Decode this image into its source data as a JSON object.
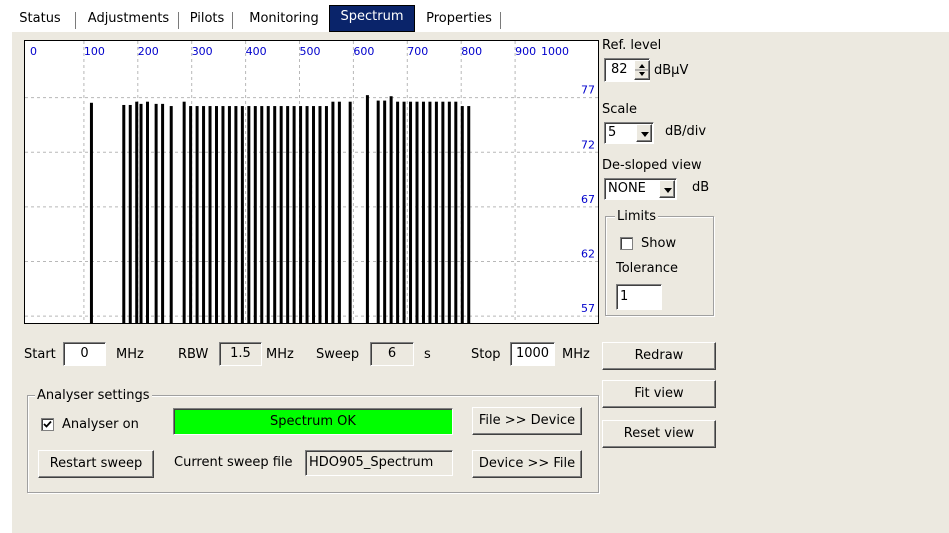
{
  "tabs": [
    {
      "label": "Status",
      "active": false
    },
    {
      "label": "Adjustments",
      "active": false
    },
    {
      "label": "Pilots",
      "active": false
    },
    {
      "label": "Monitoring",
      "active": false
    },
    {
      "label": "Spectrum",
      "active": true
    },
    {
      "label": "Properties",
      "active": false
    }
  ],
  "chart_data": {
    "type": "bar",
    "x_ticks": [
      0,
      100,
      200,
      300,
      400,
      500,
      600,
      700,
      800,
      900,
      1000
    ],
    "y_ticks": [
      77,
      72,
      67,
      62,
      57
    ],
    "xlim": [
      0,
      1000
    ],
    "ylim": [
      56,
      81
    ],
    "grid": true,
    "bar_color": "#000000",
    "tick_color": "#0000cc",
    "series": [
      {
        "x": [
          114,
          174,
          186,
          198,
          206,
          218,
          234,
          246,
          262,
          286,
          298,
          310,
          322,
          334,
          346,
          358,
          370,
          382,
          394,
          406,
          418,
          430,
          442,
          454,
          466,
          478,
          490,
          502,
          514,
          526,
          538,
          550,
          562,
          574,
          594,
          626,
          646,
          658,
          670,
          682,
          694,
          706,
          718,
          730,
          742,
          754,
          766,
          778,
          790,
          802,
          814
        ],
        "values": [
          75.8,
          75.6,
          75.6,
          75.9,
          75.7,
          75.9,
          75.7,
          75.7,
          75.5,
          75.9,
          75.5,
          75.5,
          75.5,
          75.5,
          75.5,
          75.5,
          75.5,
          75.5,
          75.5,
          75.5,
          75.5,
          75.5,
          75.5,
          75.5,
          75.5,
          75.5,
          75.5,
          75.5,
          75.5,
          75.5,
          75.5,
          75.5,
          75.9,
          75.9,
          75.9,
          76.5,
          76.0,
          76.0,
          76.4,
          75.9,
          75.9,
          75.9,
          75.9,
          75.9,
          75.9,
          75.9,
          75.9,
          75.9,
          75.9,
          75.5,
          75.5
        ]
      }
    ]
  },
  "ref_level": {
    "label": "Ref. level",
    "value": "82",
    "unit": "dBµV"
  },
  "scale": {
    "label": "Scale",
    "value": "5",
    "unit": "dB/div"
  },
  "desloped": {
    "label": "De-sloped view",
    "value": "NONE",
    "unit": "dB"
  },
  "limits": {
    "label": "Limits",
    "show_label": "Show",
    "show_checked": false,
    "tolerance_label": "Tolerance",
    "tolerance_value": "1"
  },
  "sweep": {
    "start_label": "Start",
    "start_value": "0",
    "start_unit": "MHz",
    "rbw_label": "RBW",
    "rbw_value": "1.5",
    "rbw_unit": "MHz",
    "sweep_label": "Sweep",
    "sweep_value": "6",
    "sweep_unit": "s",
    "stop_label": "Stop",
    "stop_value": "1000",
    "stop_unit": "MHz"
  },
  "buttons": {
    "redraw": "Redraw",
    "fit_view": "Fit view",
    "reset_view": "Reset view",
    "file_to_device": "File >> Device",
    "device_to_file": "Device >> File",
    "restart_sweep": "Restart sweep"
  },
  "analyser": {
    "group_label": "Analyser settings",
    "on_label": "Analyser on",
    "on_checked": true,
    "status_text": "Spectrum OK",
    "status_color": "#00ff00",
    "sweep_file_label": "Current sweep file",
    "sweep_file_value": "HDO905_Spectrum"
  }
}
